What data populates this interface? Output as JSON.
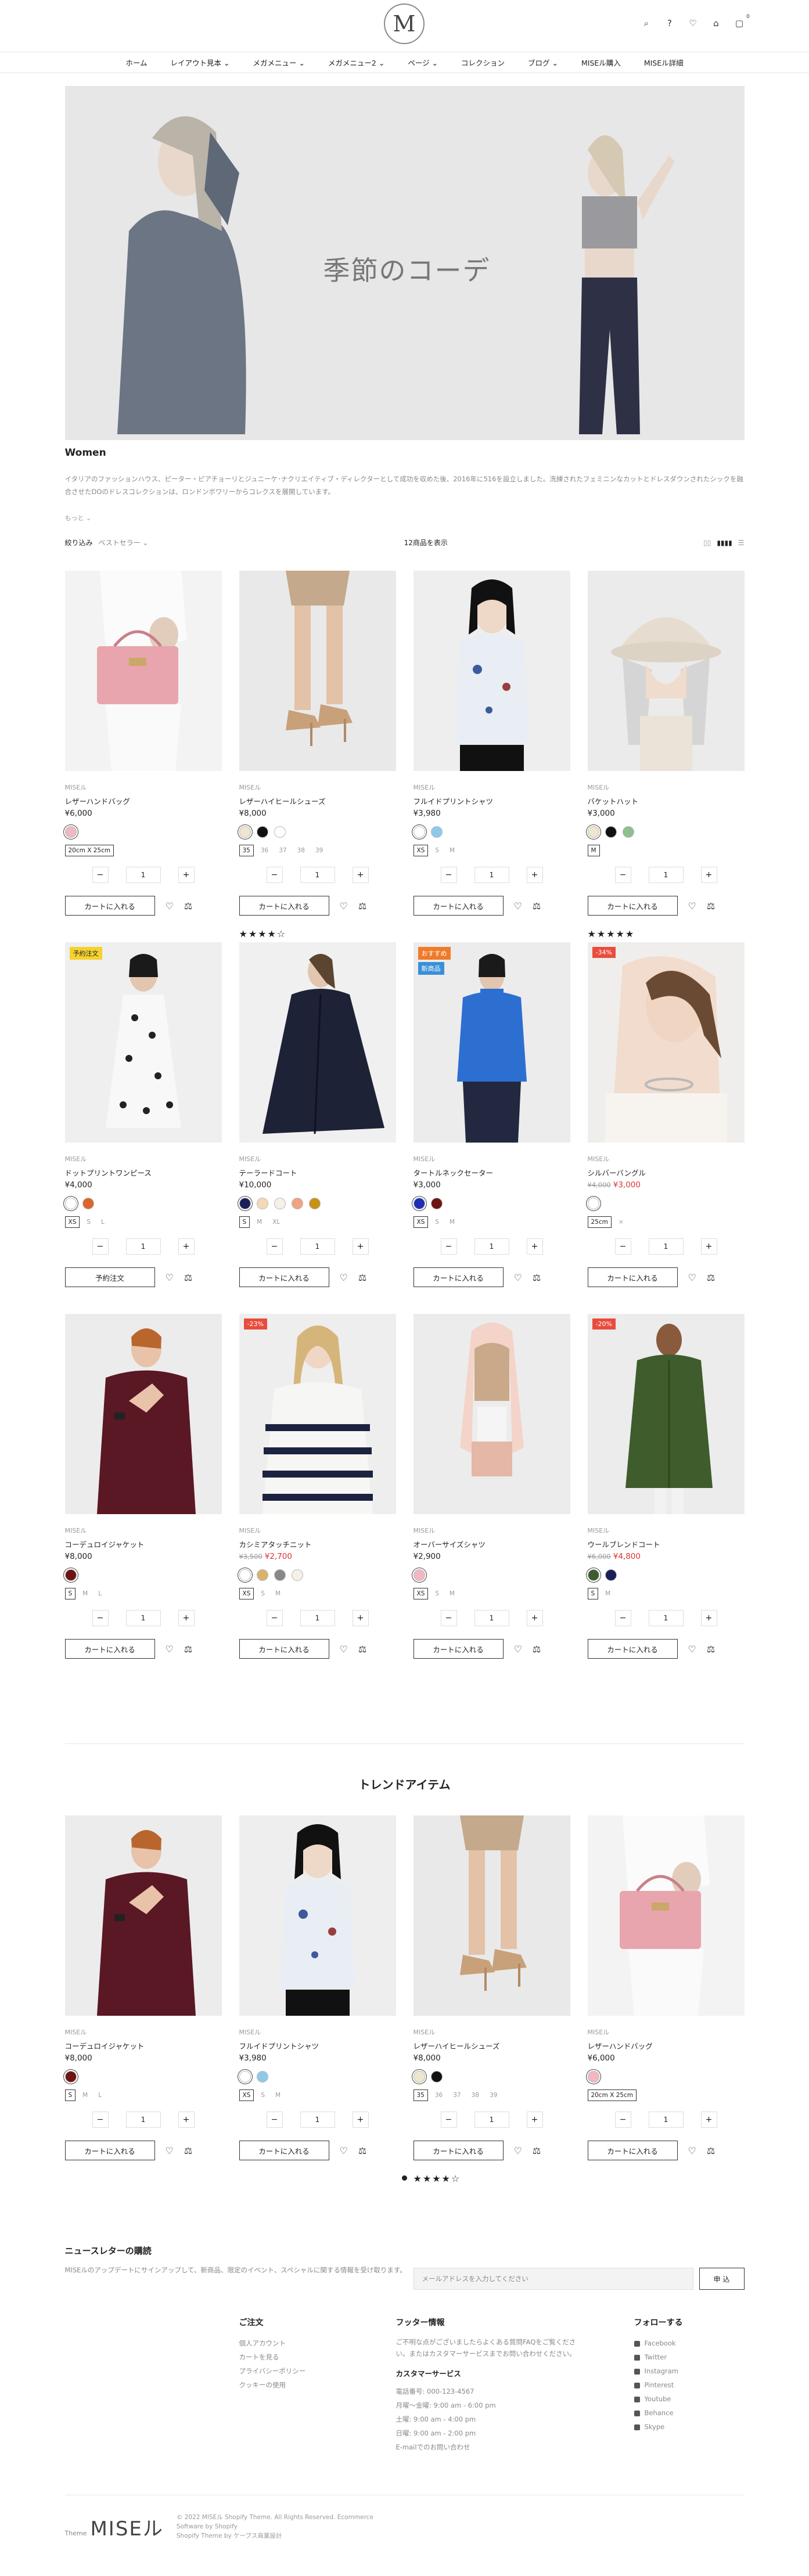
{
  "header": {
    "logo_letter": "M",
    "icons": [
      "search-icon",
      "help-icon",
      "heart-icon",
      "store-icon",
      "cart-icon"
    ],
    "cart_count": "0"
  },
  "nav": [
    "ホーム",
    "レイアウト見本 ⌄",
    "メガメニュー ⌄",
    "メガメニュー2 ⌄",
    "ページ ⌄",
    "コレクション",
    "ブログ ⌄",
    "MISEル購入",
    "MISEル詳細"
  ],
  "hero": {
    "title": "季節のコーデ"
  },
  "section": {
    "title": "Women",
    "description": "イタリアのファッションハウス、ピーター・ピアチョーリとジュニーケ･ナクリエイティブ・ディレクターとして成功を収めた後、2016年に516を設立しました。洗練されたフェミニンなカットとドレスダウンされたシックを融合させたDOのドレスコレクションは、ロンドンボワリーからコレクスを展開しています。",
    "more": "もっと ⌄",
    "sort_label": "絞り込み",
    "sort_value": "ベストセラー ⌄",
    "count": "12商品を表示"
  },
  "labels": {
    "add_to_cart": "カートに入れる",
    "preorder": "予約注文",
    "qty": "1"
  },
  "colors": {
    "badge_sale": "#e94c3c",
    "badge_pre": "#f5d22e",
    "badge_rec": "#f07a2a",
    "badge_new": "#3a8fd9"
  },
  "products": [
    {
      "vendor": "MISEル",
      "name": "レザーハンドバッグ",
      "price": "¥6,000",
      "swatches": [
        "#f2b7c3"
      ],
      "sizes": [
        "20cm X 25cm"
      ],
      "sel": 0,
      "img": "bag"
    },
    {
      "vendor": "MISEル",
      "name": "レザーハイヒールシューズ",
      "price": "¥8,000",
      "swatches": [
        "#efe6cf",
        "#111111",
        "#ffffff"
      ],
      "sizes": [
        "35",
        "36",
        "37",
        "38",
        "39"
      ],
      "sel": 0,
      "stars": "★★★★☆",
      "img": "heels"
    },
    {
      "vendor": "MISEル",
      "name": "フルイドプリントシャツ",
      "price": "¥3,980",
      "swatches": [
        "#ffffff",
        "#8fc9ea"
      ],
      "sizes": [
        "XS",
        "S",
        "M"
      ],
      "sel": 0,
      "img": "shirt"
    },
    {
      "vendor": "MISEル",
      "name": "バケットハット",
      "price": "¥3,000",
      "swatches": [
        "#efe6cf",
        "#111111",
        "#8fbf8c"
      ],
      "sizes": [
        "M"
      ],
      "sel": 0,
      "stars": "★★★★★",
      "img": "hat"
    },
    {
      "vendor": "MISEル",
      "name": "ドットプリントワンピース",
      "price": "¥4,000",
      "swatches": [
        "#ffffff",
        "#d9662b"
      ],
      "sizes": [
        "XS",
        "S",
        "L"
      ],
      "sel": 0,
      "badge": "予約注文",
      "badge_color": "#f5d22e",
      "badge_text": "#222222",
      "btn": "予約注文",
      "img": "dress"
    },
    {
      "vendor": "MISEル",
      "name": "テーラードコート",
      "price": "¥10,000",
      "swatches": [
        "#1a1f5a",
        "#f4d9b8",
        "#f6f1e8",
        "#f1a27e",
        "#c79216"
      ],
      "sizes": [
        "S",
        "M",
        "XL"
      ],
      "sel": 0,
      "img": "coat"
    },
    {
      "vendor": "MISEル",
      "name": "タートルネックセーター",
      "price": "¥3,000",
      "swatches": [
        "#1e2fb8",
        "#6e1414"
      ],
      "sizes": [
        "XS",
        "S",
        "M"
      ],
      "sel": 0,
      "badge": "おすすめ",
      "badge_color": "#f07a2a",
      "badge_text": "#ffffff",
      "badge2": "新商品",
      "badge2_color": "#3a8fd9",
      "img": "sweater"
    },
    {
      "vendor": "MISEル",
      "name": "シルバーバングル",
      "price_old": "¥4,000",
      "price_sale": "¥3,000",
      "swatches": [
        "#ffffff"
      ],
      "sizes": [
        "25cm",
        "×"
      ],
      "sel": 0,
      "badge": "-34%",
      "badge_color": "#e94c3c",
      "badge_text": "#ffffff",
      "img": "bangle"
    },
    {
      "vendor": "MISEル",
      "name": "コーデュロイジャケット",
      "price": "¥8,000",
      "swatches": [
        "#6e1414"
      ],
      "sizes": [
        "S",
        "M",
        "L"
      ],
      "sel": 0,
      "img": "jacket"
    },
    {
      "vendor": "MISEル",
      "name": "カシミアタッチニット",
      "price_old": "¥3,500",
      "price_sale": "¥2,700",
      "swatches": [
        "#ffffff",
        "#d9b36e",
        "#888888",
        "#f6f1e8"
      ],
      "sizes": [
        "XS",
        "S",
        "M"
      ],
      "sel": 0,
      "badge": "-23%",
      "badge_color": "#e94c3c",
      "badge_text": "#ffffff",
      "img": "knit"
    },
    {
      "vendor": "MISEル",
      "name": "オーバーサイズシャツ",
      "price": "¥2,900",
      "swatches": [
        "#f2b7c3"
      ],
      "sizes": [
        "XS",
        "S",
        "M"
      ],
      "sel": 0,
      "img": "pinkshirt"
    },
    {
      "vendor": "MISEル",
      "name": "ウールブレンドコート",
      "price_old": "¥6,000",
      "price_sale": "¥4,800",
      "swatches": [
        "#3f5c2c",
        "#1a1f5a"
      ],
      "sizes": [
        "S",
        "M"
      ],
      "sel": 0,
      "badge": "-20%",
      "badge_color": "#e94c3c",
      "badge_text": "#ffffff",
      "img": "woolcoat"
    }
  ],
  "trend": {
    "title": "トレンドアイテム",
    "products": [
      {
        "vendor": "MISEル",
        "name": "コーデュロイジャケット",
        "price": "¥8,000",
        "swatches": [
          "#6e1414"
        ],
        "sizes": [
          "S",
          "M",
          "L"
        ],
        "sel": 0,
        "img": "jacket"
      },
      {
        "vendor": "MISEル",
        "name": "フルイドプリントシャツ",
        "price": "¥3,980",
        "swatches": [
          "#ffffff",
          "#8fc9ea"
        ],
        "sizes": [
          "XS",
          "S",
          "M"
        ],
        "sel": 0,
        "img": "shirt"
      },
      {
        "vendor": "MISEル",
        "name": "レザーハイヒールシューズ",
        "price": "¥8,000",
        "swatches": [
          "#efe6cf",
          "#111111"
        ],
        "sizes": [
          "35",
          "36",
          "37",
          "38",
          "39"
        ],
        "sel": 0,
        "stars": "★★★★☆",
        "img": "heels"
      },
      {
        "vendor": "MISEル",
        "name": "レザーハンドバッグ",
        "price": "¥6,000",
        "swatches": [
          "#f2b7c3"
        ],
        "sizes": [
          "20cm X 25cm"
        ],
        "sel": 0,
        "img": "bag"
      }
    ]
  },
  "footer": {
    "nl_title": "ニュースレターの購読",
    "nl_desc": "MISEルのアップデートにサインアップして、新商品、限定のイベント、スペシャルに関する情報を受け取ります。",
    "nl_placeholder": "メールアドレスを入力してください",
    "nl_button": "申 込",
    "col1_title": "ご注文",
    "col1_items": [
      "個人アカウント",
      "カートを見る",
      "プライバシーポリシー",
      "クッキーの使用"
    ],
    "col2_title": "フッター情報",
    "col2_text": "ご不明な点がございましたらよくある質問FAQをご覧ください。またはカスタマーサービスまでお問い合わせください。",
    "cs_title": "カスタマーサービス",
    "cs_items": [
      "電話番号: 000-123-4567",
      "月曜～金曜: 9:00 am - 6:00 pm",
      "土曜: 9:00 am - 4:00 pm",
      "日曜: 9:00 am - 2:00 pm",
      "E-mailでのお問い合わせ"
    ],
    "col3_title": "フォローする",
    "social": [
      "Facebook",
      "Twitter",
      "Instagram",
      "Pinterest",
      "Youtube",
      "Behance",
      "Skype"
    ],
    "logo_small": "Theme",
    "logo": "MISEル",
    "copyright": [
      "© 2022 MISEル Shopify Theme. All Rights Reserved. Ecommerce",
      "Software by Shopify",
      "Shopify Theme by ケープス商業設計"
    ],
    "totop": "↑"
  }
}
